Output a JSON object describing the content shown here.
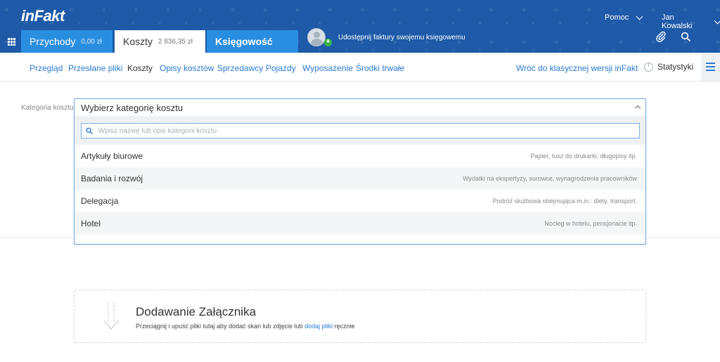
{
  "header": {
    "logo": "inFakt",
    "help_label": "Pomoc",
    "user_name": "Jan Kowalski",
    "tabs": [
      {
        "label": "Przychody",
        "amount": "0,00 zł"
      },
      {
        "label": "Koszty",
        "amount": "2 836,35 zł"
      },
      {
        "label": "Księgowość",
        "amount": ""
      }
    ],
    "share_text": "Udostępnij faktury swojemu księgowemu"
  },
  "subnav": {
    "items": [
      "Przegląd",
      "Przesłane pliki",
      "Koszty",
      "Opisy kosztów",
      "Sprzedawcy",
      "Pojazdy",
      "Wyposażenie",
      "Środki trwałe"
    ],
    "active_index": 2,
    "classic_link": "Wróć do klasycznej wersji inFakt",
    "stats_label": "Statystyki"
  },
  "form": {
    "label": "Kategoria kosztu",
    "select_value": "Wybierz kategorię kosztu",
    "search_placeholder": "Wpisz nazwę lub opis kategorii kosztu",
    "options": [
      {
        "name": "Artykuły biurowe",
        "desc": "Papier, tusz do drukarki, długopisy itp."
      },
      {
        "name": "Badania i rozwój",
        "desc": "Wydatki na ekspertyzy, surowce, wynagrodzenia pracowników"
      },
      {
        "name": "Delegacja",
        "desc": "Podróż służbowa obejmująca m.in.: diety, transport."
      },
      {
        "name": "Hotel",
        "desc": "Nocleg w hotelu, pensjonacie itp."
      }
    ]
  },
  "attachment": {
    "title": "Dodawanie Załącznika",
    "text_before": "Przeciągnij i upuść pliki tutaj aby dodać skan lub zdjęcie lub ",
    "link": "dodaj pliki",
    "text_after": " ręcznie"
  },
  "colors": {
    "header_bg": "#1e5aa8",
    "tab_blue": "#2a8ee0",
    "link_blue": "#2a7bd3",
    "add_green": "#3cb44a"
  }
}
